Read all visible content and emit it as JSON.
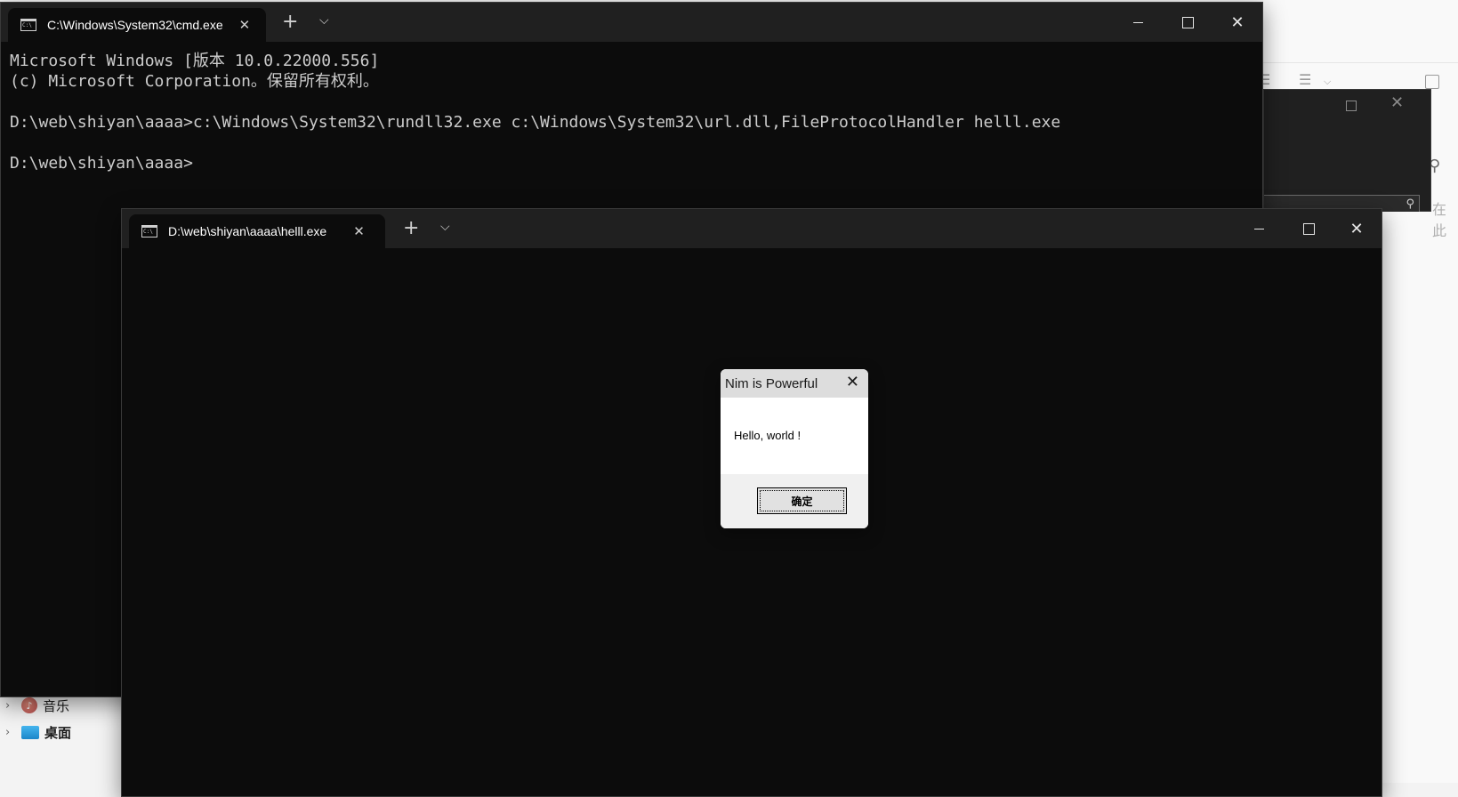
{
  "colors": {
    "terminal_bg": "#0c0c0c",
    "titlebar_bg": "#202020",
    "console_fg": "#cccccc"
  },
  "explorer_nav": {
    "items": [
      {
        "label": "音乐",
        "icon": "music-icon"
      },
      {
        "label": "桌面",
        "icon": "desktop-icon"
      }
    ]
  },
  "bg_explorer": {
    "side_text": "在此"
  },
  "cmd_window": {
    "tab_title": "C:\\Windows\\System32\\cmd.exe",
    "lines": [
      "Microsoft Windows [版本 10.0.22000.556]",
      "(c) Microsoft Corporation。保留所有权利。",
      "",
      "D:\\web\\shiyan\\aaaa>c:\\Windows\\System32\\rundll32.exe c:\\Windows\\System32\\url.dll,FileProtocolHandler helll.exe",
      "",
      "D:\\web\\shiyan\\aaaa>"
    ]
  },
  "helll_window": {
    "tab_title": "D:\\web\\shiyan\\aaaa\\helll.exe"
  },
  "message_box": {
    "title": "Nim is Powerful",
    "message": "Hello, world !",
    "ok_label": "确定"
  }
}
